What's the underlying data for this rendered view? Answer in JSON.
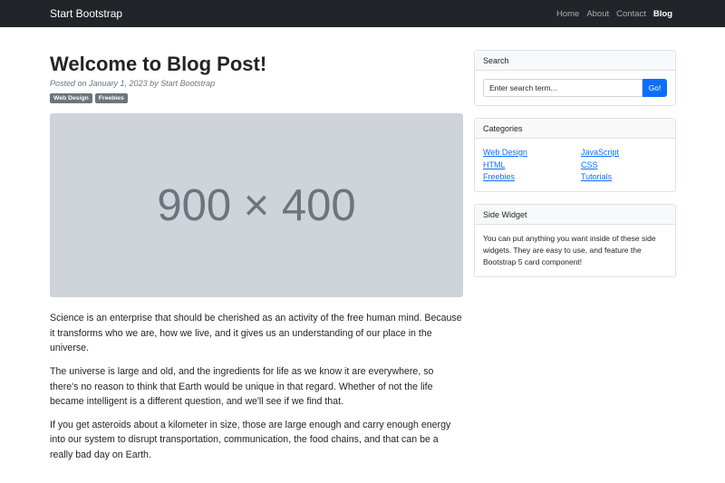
{
  "navbar": {
    "brand": "Start Bootstrap",
    "links": [
      "Home",
      "About",
      "Contact",
      "Blog"
    ]
  },
  "post": {
    "title": "Welcome to Blog Post!",
    "meta": "Posted on January 1, 2023 by Start Bootstrap",
    "badges": [
      "Web Design",
      "Freebies"
    ],
    "image_label": "900 × 400",
    "paragraphs": [
      "Science is an enterprise that should be cherished as an activity of the free human mind. Because it transforms who we are, how we live, and it gives us an understanding of our place in the universe.",
      "The universe is large and old, and the ingredients for life as we know it are everywhere, so there's no reason to think that Earth would be unique in that regard. Whether of not the life became intelligent is a different question, and we'll see if we find that.",
      "If you get asteroids about a kilometer in size, those are large enough and carry enough energy into our system to disrupt transportation, communication, the food chains, and that can be a really bad day on Earth."
    ]
  },
  "sidebar": {
    "search": {
      "header": "Search",
      "placeholder": "Enter search term...",
      "button": "Go!"
    },
    "categories": {
      "header": "Categories",
      "items": [
        "Web Design",
        "JavaScript",
        "HTML",
        "CSS",
        "Freebies",
        "Tutorials"
      ]
    },
    "widget": {
      "header": "Side Widget",
      "text": "You can put anything you want inside of these side widgets. They are easy to use, and feature the Bootstrap 5 card component!"
    }
  },
  "colors": {
    "navbar_bg": "#212529",
    "primary": "#0d6efd",
    "badge_bg": "#6c757d",
    "placeholder_bg": "#ced4da"
  }
}
